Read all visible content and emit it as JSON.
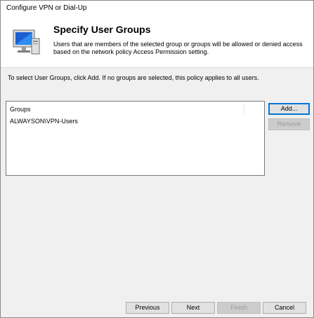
{
  "window": {
    "title": "Configure VPN or Dial-Up"
  },
  "header": {
    "title": "Specify User Groups",
    "description": "Users that are members of the selected group or groups will be allowed or denied access based on the network policy Access Permission setting."
  },
  "instruction": "To select User Groups, click Add. If no groups are selected, this policy applies to all users.",
  "groups": {
    "column_header": "Groups",
    "items": [
      "ALWAYSON\\VPN-Users"
    ]
  },
  "buttons": {
    "add": "Add...",
    "remove": "Remove",
    "previous": "Previous",
    "next": "Next",
    "finish": "Finish",
    "cancel": "Cancel"
  }
}
